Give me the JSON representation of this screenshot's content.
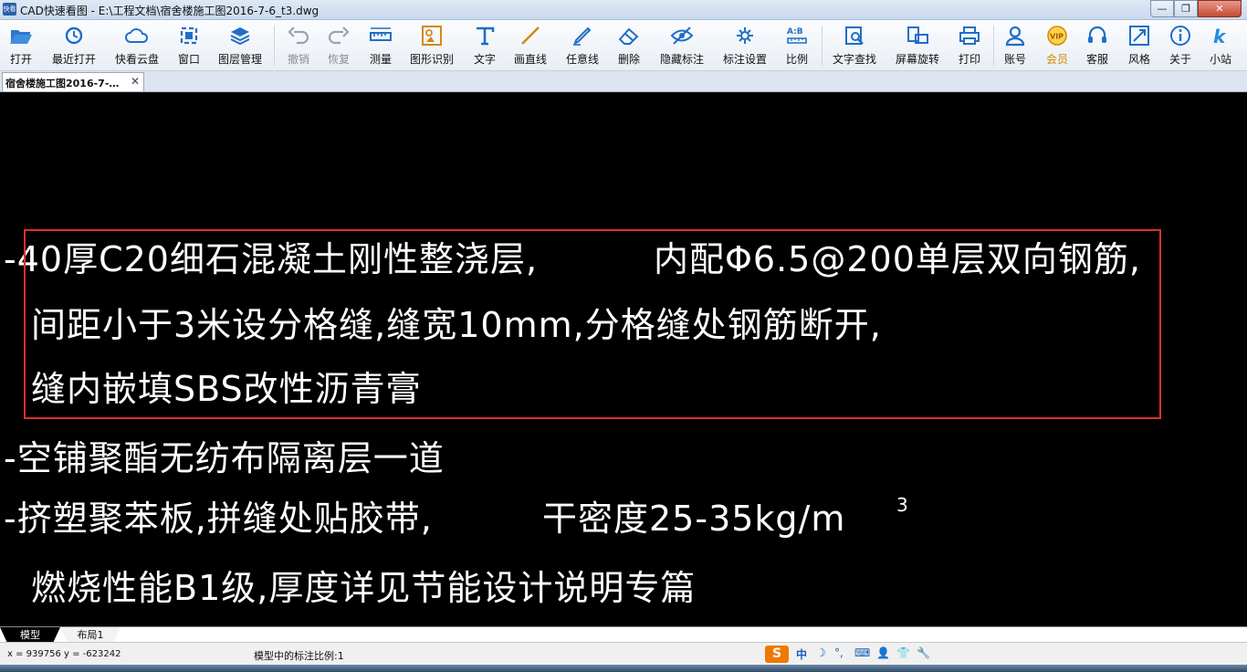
{
  "window": {
    "title": "CAD快速看图 - E:\\工程文档\\宿舍楼施工图2016-7-6_t3.dwg",
    "app_icon_text": "快看",
    "minimize": "—",
    "maximize": "❐",
    "close": "✕"
  },
  "toolbar": {
    "items": [
      {
        "label": "打开",
        "icon": "folder-open-icon"
      },
      {
        "label": "最近打开",
        "icon": "clock-icon"
      },
      {
        "label": "快看云盘",
        "icon": "cloud-icon"
      },
      {
        "label": "窗口",
        "icon": "window-icon"
      },
      {
        "label": "图层管理",
        "icon": "layers-icon"
      },
      {
        "label": "撤销",
        "icon": "undo-icon"
      },
      {
        "label": "恢复",
        "icon": "redo-icon"
      },
      {
        "label": "测量",
        "icon": "ruler-icon"
      },
      {
        "label": "图形识别",
        "icon": "shape-recognize-icon"
      },
      {
        "label": "文字",
        "icon": "text-icon"
      },
      {
        "label": "画直线",
        "icon": "line-icon"
      },
      {
        "label": "任意线",
        "icon": "pen-icon"
      },
      {
        "label": "删除",
        "icon": "eraser-icon"
      },
      {
        "label": "隐藏标注",
        "icon": "eye-hide-icon"
      },
      {
        "label": "标注设置",
        "icon": "settings-icon"
      },
      {
        "label": "比例",
        "icon": "scale-icon"
      },
      {
        "label": "文字查找",
        "icon": "text-search-icon"
      },
      {
        "label": "屏幕旋转",
        "icon": "rotate-icon"
      },
      {
        "label": "打印",
        "icon": "printer-icon"
      },
      {
        "label": "账号",
        "icon": "user-icon"
      },
      {
        "label": "会员",
        "icon": "vip-icon"
      },
      {
        "label": "客服",
        "icon": "headset-icon"
      },
      {
        "label": "风格",
        "icon": "style-icon"
      },
      {
        "label": "关于",
        "icon": "info-icon"
      },
      {
        "label": "小站",
        "icon": "k-logo-icon"
      }
    ],
    "colors": {
      "icon_blue": "#1f6fc5",
      "disabled": "#9aa3ad",
      "vip": "#e59b00"
    }
  },
  "document_tab": {
    "label": "宿舍楼施工图2016-7-…",
    "close": "✕"
  },
  "canvas": {
    "lines": [
      "-40厚C20细石混凝土刚性整浇层,",
      "内配Φ6.5@200单层双向钢筋,",
      "间距小于3米设分格缝,缝宽10mm,分格缝处钢筋断开,",
      "缝内嵌填SBS改性沥青膏",
      "-空铺聚酯无纺布隔离层一道",
      "-挤塑聚苯板,拼缝处贴胶带,",
      "干密度25-35kg/m",
      "3",
      "燃烧性能B1级,厚度详见节能设计说明专篇"
    ],
    "selection_color": "#e0302b",
    "background": "#000000",
    "text_color": "#ffffff"
  },
  "layout_tabs": [
    {
      "label": "模型"
    },
    {
      "label": "布局1"
    }
  ],
  "status": {
    "coords": "x = 939756  y = -623242",
    "scale": "模型中的标注比例:1"
  },
  "ime": {
    "logo": "S",
    "items": [
      "中",
      "☽",
      "°,",
      "⌨",
      "👤",
      "👕",
      "🔧"
    ]
  }
}
